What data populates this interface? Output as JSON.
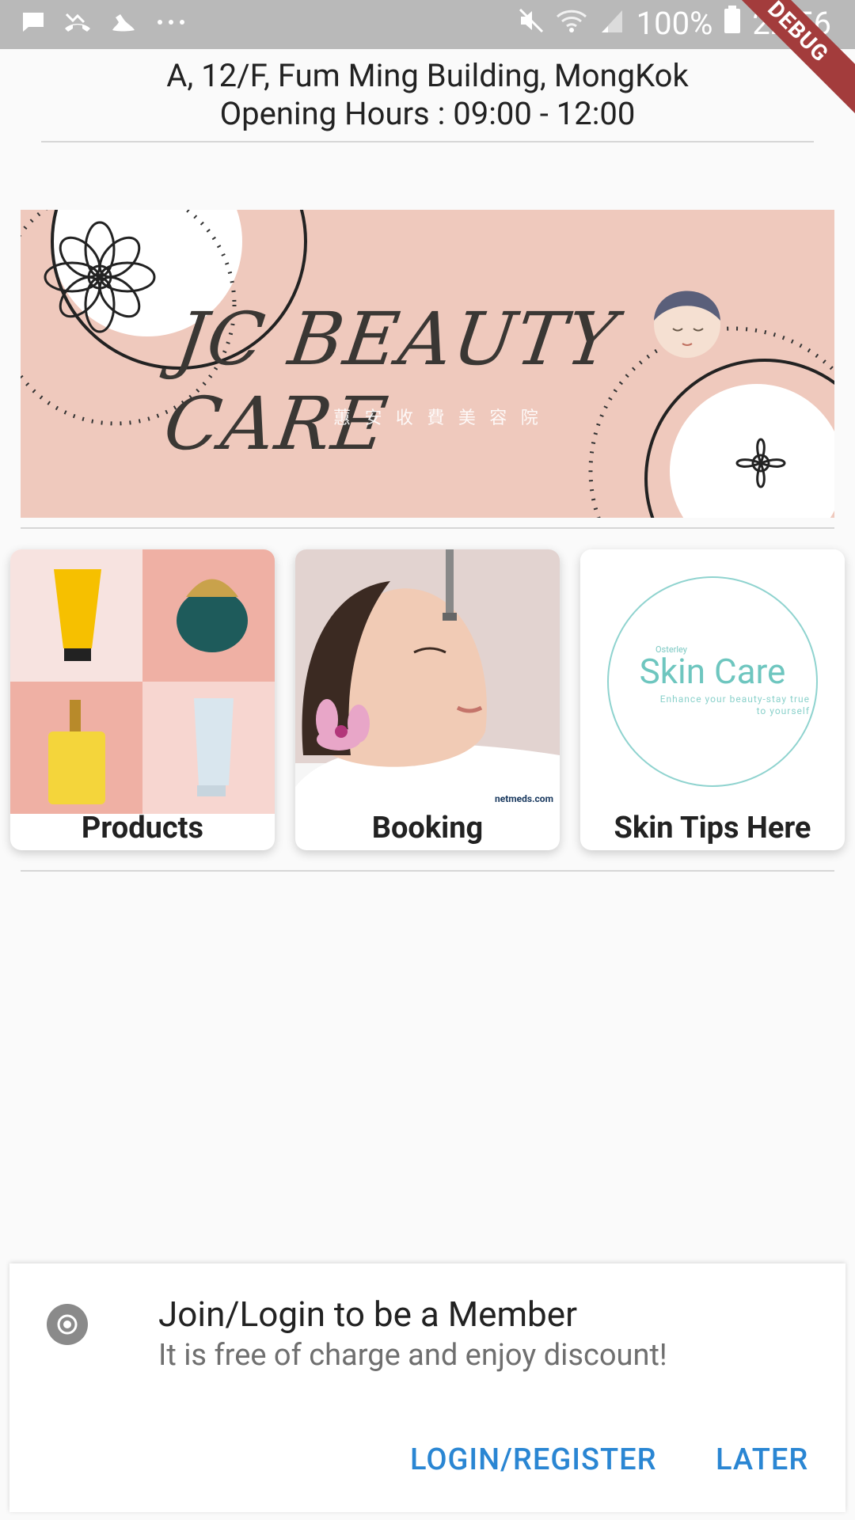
{
  "status_bar": {
    "battery": "100%",
    "time": "22:56",
    "debug_ribbon": "DEBUG",
    "icons": [
      "message-icon",
      "missed-call-icon",
      "fitness-icon",
      "more-icon",
      "mute-icon",
      "wifi-icon",
      "signal-icon",
      "battery-icon"
    ]
  },
  "header": {
    "address": "A, 12/F, Fum Ming Building, MongKok",
    "hours": "Opening Hours : 09:00 - 12:00"
  },
  "banner": {
    "title": "JC BEAUTY CARE",
    "subtitle": "蕙 安 收 費 美 容 院"
  },
  "cards": [
    {
      "label": "Products"
    },
    {
      "label": "Booking"
    },
    {
      "label": "Skin Tips Here"
    }
  ],
  "skin_logo": {
    "brand": "Osterley",
    "title": "Skin Care",
    "tagline_1": "Enhance your beauty-stay true",
    "tagline_2": "to yourself"
  },
  "booking_watermark": "netmeds.com",
  "member_sheet": {
    "title": "Join/Login to be a Member",
    "subtitle": "It is free of charge and enjoy discount!",
    "login_button": "LOGIN/REGISTER",
    "later_button": "LATER"
  },
  "colors": {
    "accent": "#2a86d3",
    "banner_bg": "#efc9bd",
    "status_bar": "#b9b9b9"
  }
}
